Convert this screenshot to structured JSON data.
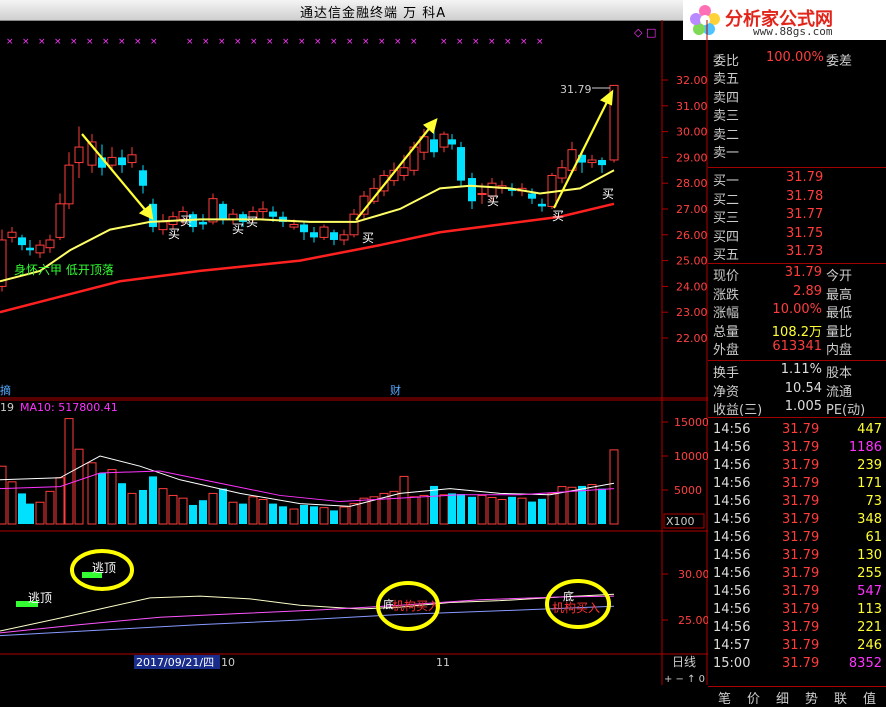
{
  "window": {
    "title": "通达信金融终端    万 科A"
  },
  "logo": {
    "name": "分析家公式网",
    "url": "www.88gs.com"
  },
  "price_axis": [
    "32.00",
    "31.00",
    "30.00",
    "29.00",
    "28.00",
    "27.00",
    "26.00",
    "25.00",
    "24.00",
    "23.00",
    "22.00"
  ],
  "vol_axis": [
    "15000",
    "10000",
    "5000"
  ],
  "vol_unit": "X100",
  "ind_axis": [
    "30.00",
    "25.00"
  ],
  "chart_labels": {
    "peak": "31.79",
    "pattern": "身怀六甲 低开顶落",
    "buy": "买",
    "cai": "财",
    "escape": "逃顶",
    "ma_prefix": "19",
    "ma10": "MA10: 517800.41",
    "buy_signal": "机构买入",
    "buy_head": "底"
  },
  "date_axis": {
    "date": "2017/09/21/四",
    "m10": "10",
    "m11": "11",
    "period": "日线"
  },
  "quote_top": {
    "ratio_label": "委比",
    "ratio_value": "100.00%",
    "diff_label": "委差"
  },
  "asks": [
    {
      "label": "卖五"
    },
    {
      "label": "卖四"
    },
    {
      "label": "卖三"
    },
    {
      "label": "卖二"
    },
    {
      "label": "卖一"
    }
  ],
  "bids": [
    {
      "label": "买一",
      "price": "31.79"
    },
    {
      "label": "买二",
      "price": "31.78"
    },
    {
      "label": "买三",
      "price": "31.77"
    },
    {
      "label": "买四",
      "price": "31.75"
    },
    {
      "label": "买五",
      "price": "31.73"
    }
  ],
  "stats": [
    {
      "label": "现价",
      "value": "31.79",
      "right": "今开"
    },
    {
      "label": "涨跌",
      "value": "2.89",
      "right": "最高"
    },
    {
      "label": "涨幅",
      "value": "10.00%",
      "right": "最低"
    },
    {
      "label": "总量",
      "value": "108.2万",
      "right": "量比"
    },
    {
      "label": "外盘",
      "value": "613341",
      "right": "内盘"
    }
  ],
  "stats2": [
    {
      "label": "换手",
      "value": "1.11%",
      "right": "股本"
    },
    {
      "label": "净资",
      "value": "10.54",
      "right": "流通"
    },
    {
      "label": "收益(三)",
      "value": "1.005",
      "right": "PE(动)"
    }
  ],
  "ticks": [
    {
      "time": "14:56",
      "price": "31.79",
      "vol": "447"
    },
    {
      "time": "14:56",
      "price": "31.79",
      "vol": "1186"
    },
    {
      "time": "14:56",
      "price": "31.79",
      "vol": "239"
    },
    {
      "time": "14:56",
      "price": "31.79",
      "vol": "171"
    },
    {
      "time": "14:56",
      "price": "31.79",
      "vol": "73"
    },
    {
      "time": "14:56",
      "price": "31.79",
      "vol": "348"
    },
    {
      "time": "14:56",
      "price": "31.79",
      "vol": "61"
    },
    {
      "time": "14:56",
      "price": "31.79",
      "vol": "130"
    },
    {
      "time": "14:56",
      "price": "31.79",
      "vol": "255"
    },
    {
      "time": "14:56",
      "price": "31.79",
      "vol": "547"
    },
    {
      "time": "14:56",
      "price": "31.79",
      "vol": "113"
    },
    {
      "time": "14:56",
      "price": "31.79",
      "vol": "221"
    },
    {
      "time": "14:57",
      "price": "31.79",
      "vol": "246"
    },
    {
      "time": "15:00",
      "price": "31.79",
      "vol": "8352"
    }
  ],
  "tabs": [
    "笔",
    "价",
    "细",
    "势",
    "联",
    "值"
  ],
  "colors": {
    "up": "#ff3d3d",
    "down": "#00e0ff",
    "ma_fast": "#ffff66",
    "ma_slow": "#ff2020"
  }
}
